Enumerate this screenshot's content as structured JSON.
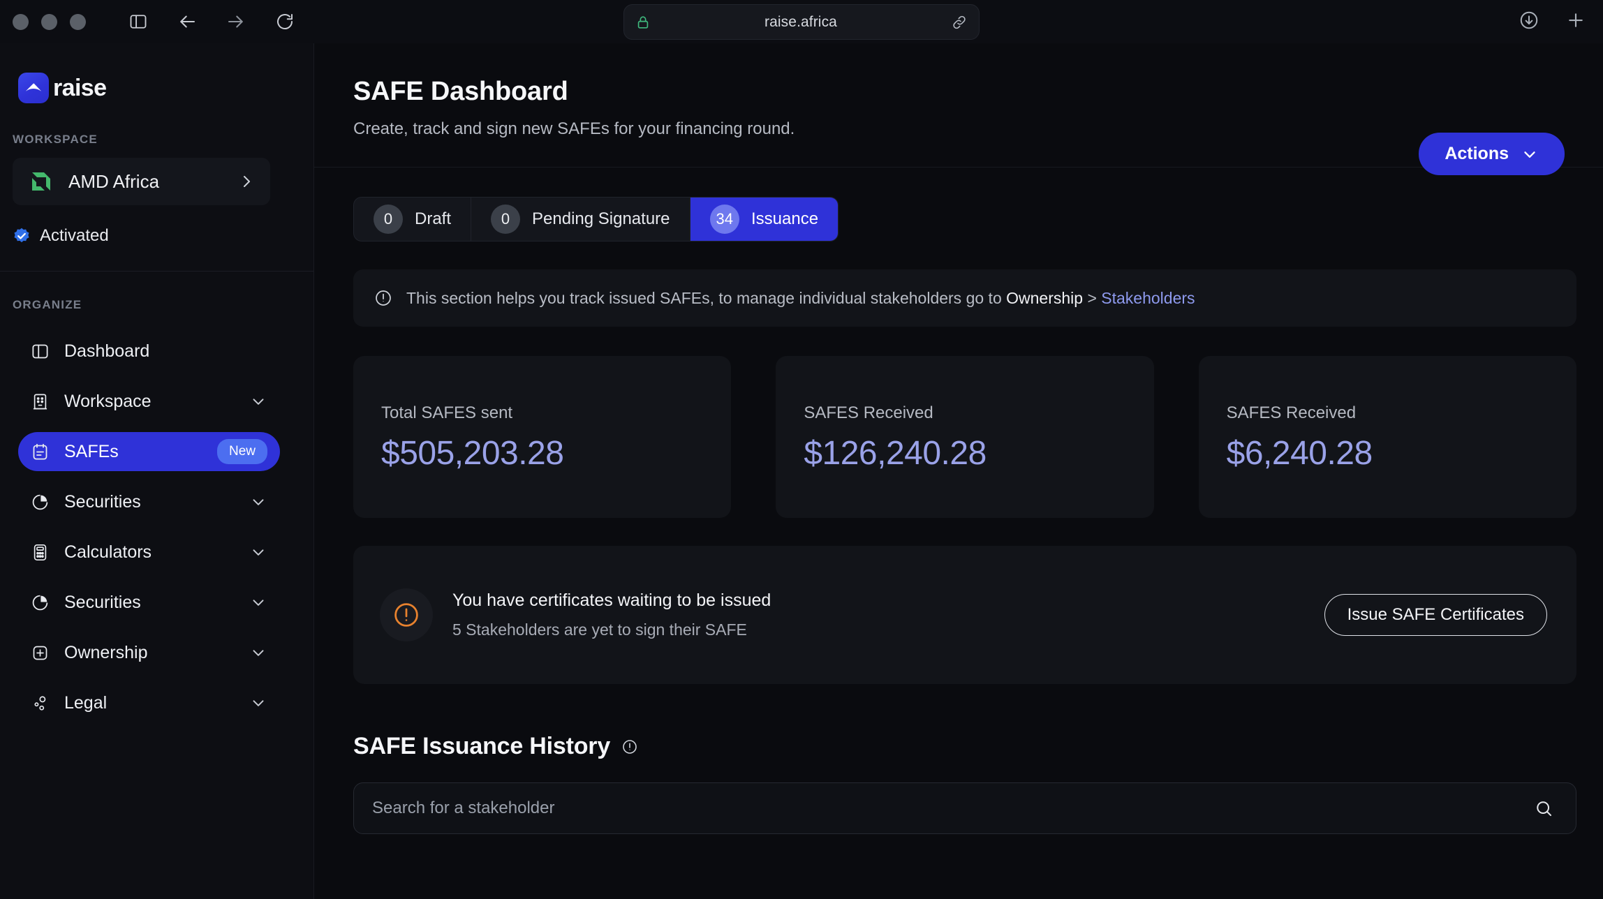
{
  "browser": {
    "url": "raise.africa",
    "lock_icon": "lock-icon",
    "share_icon": "link-share-icon",
    "sidebar_toggle_icon": "sidebar-toggle-icon",
    "back_icon": "back-arrow-icon",
    "forward_icon": "forward-arrow-icon",
    "reload_icon": "reload-icon",
    "downloads_icon": "download-icon",
    "new_tab_icon": "plus-icon"
  },
  "sidebar": {
    "brand": "raise",
    "workspace_label": "WORKSPACE",
    "workspace": {
      "name": "AMD Africa",
      "chevron_icon": "chevron-right-icon"
    },
    "status": "Activated",
    "organize_label": "ORGANIZE",
    "items": [
      {
        "label": "Dashboard",
        "icon": "panel-icon",
        "active": false,
        "chevron": false,
        "badge": null
      },
      {
        "label": "Workspace",
        "icon": "building-icon",
        "active": false,
        "chevron": true,
        "badge": null
      },
      {
        "label": "SAFEs",
        "icon": "document-icon",
        "active": true,
        "chevron": false,
        "badge": "New"
      },
      {
        "label": "Securities",
        "icon": "pie-chart-icon",
        "active": false,
        "chevron": true,
        "badge": null
      },
      {
        "label": "Calculators",
        "icon": "calculator-icon",
        "active": false,
        "chevron": true,
        "badge": null
      },
      {
        "label": "Securities",
        "icon": "pie-chart-icon",
        "active": false,
        "chevron": true,
        "badge": null
      },
      {
        "label": "Ownership",
        "icon": "grid-icon",
        "active": false,
        "chevron": true,
        "badge": null
      },
      {
        "label": "Legal",
        "icon": "nodes-icon",
        "active": false,
        "chevron": true,
        "badge": null
      }
    ]
  },
  "header": {
    "title": "SAFE Dashboard",
    "subtitle": "Create, track and sign new SAFEs for your financing round.",
    "actions_label": "Actions",
    "actions_chevron_icon": "chevron-down-icon"
  },
  "tabs": [
    {
      "count": "0",
      "label": "Draft",
      "active": false
    },
    {
      "count": "0",
      "label": "Pending Signature",
      "active": false
    },
    {
      "count": "34",
      "label": "Issuance",
      "active": true
    }
  ],
  "info_banner": {
    "icon": "circle-alert-icon",
    "text_before": "This section helps you track issued SAFEs, to manage individual stakeholders go to ",
    "strong": "Ownership",
    "separator": " > ",
    "link": "Stakeholders"
  },
  "stats": [
    {
      "label": "Total SAFES sent",
      "value": "$505,203.28"
    },
    {
      "label": "SAFES Received",
      "value": "$126,240.28"
    },
    {
      "label": "SAFES Received",
      "value": "$6,240.28"
    }
  ],
  "alert": {
    "icon": "warning-circle-icon",
    "title": "You have certificates waiting to be issued",
    "subtitle": "5 Stakeholders are yet to sign their SAFE",
    "button": "Issue SAFE Certificates"
  },
  "history": {
    "title": "SAFE Issuance History",
    "info_icon": "circle-info-icon",
    "search_placeholder": "Search for a stakeholder",
    "search_value": "",
    "search_icon": "search-icon"
  },
  "colors": {
    "accent_blue": "#2f32d8",
    "badge_blue": "#4c6ef0",
    "stat_value": "#9aa2e8",
    "link": "#8e9aee",
    "warning_orange": "#e8822e",
    "workspace_green": "#3fbf70",
    "page_bg": "#0a0b0f",
    "card_bg": "#121419"
  }
}
